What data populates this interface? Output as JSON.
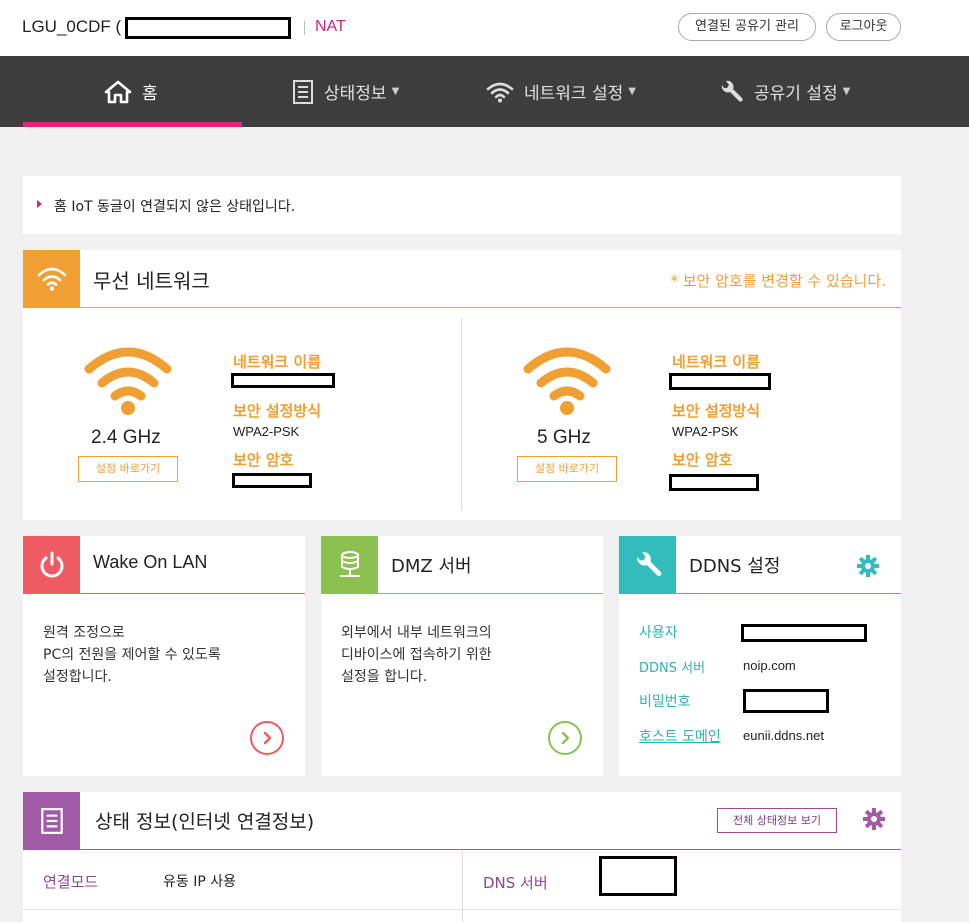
{
  "header": {
    "model": "LGU_0CDF (",
    "mode": "NAT",
    "manage_btn": "연결된 공유기 관리",
    "logout_btn": "로그아웃"
  },
  "nav": {
    "home": "홈",
    "status": "상태정보",
    "network": "네트워크 설정",
    "router": "공유기 설정"
  },
  "notice": {
    "text": "홈 IoT 동글이 연결되지 않은 상태입니다."
  },
  "wireless": {
    "title": "무선 네트워크",
    "hint": "* 보안 암호를 변경할 수 있습니다.",
    "band24": {
      "band": "2.4 GHz",
      "button": "설정 바로가기",
      "name_label": "네트워크 이름",
      "security_label": "보안 설정방식",
      "security_value": "WPA2-PSK",
      "password_label": "보안 암호"
    },
    "band5": {
      "band": "5 GHz",
      "button": "설정 바로가기",
      "name_label": "네트워크 이름",
      "security_label": "보안 설정방식",
      "security_value": "WPA2-PSK",
      "password_label": "보안 암호"
    }
  },
  "wol": {
    "title": "Wake On LAN",
    "desc": [
      "원격 조정으로",
      "PC의 전원을 제어할 수 있도록",
      "설정합니다."
    ]
  },
  "dmz": {
    "title": "DMZ 서버",
    "desc": [
      "외부에서 내부 네트워크의",
      "디바이스에 접속하기 위한",
      "설정을 합니다."
    ]
  },
  "ddns": {
    "title": "DDNS 설정",
    "user_label": "사용자",
    "server_label": "DDNS 서버",
    "server_value": "noip.com",
    "password_label": "비밀번호",
    "host_label": "호스트 도메인",
    "host_value": "eunii.ddns.net"
  },
  "status": {
    "title": "상태 정보(인터넷 연결정보)",
    "full_btn": "전체 상태정보 보기",
    "mode_label": "연결모드",
    "mode_value": "유동 IP 사용",
    "dns_label": "DNS 서버"
  },
  "colors": {
    "accent": "#e3247d",
    "nav_bg": "#3d3d3d",
    "wifi": "#f0a033",
    "wol": "#ef5b63",
    "dmz": "#8cc152",
    "ddns": "#33bcbd",
    "status": "#a05aa6"
  }
}
